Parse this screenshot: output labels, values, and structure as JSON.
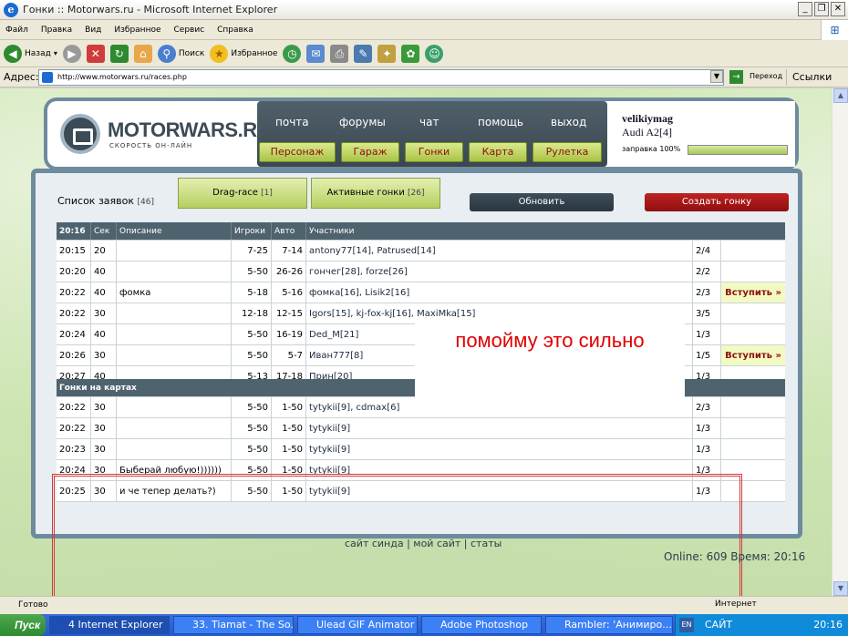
{
  "window": {
    "title": "Гонки :: Motorwars.ru - Microsoft Internet Explorer"
  },
  "menu": [
    "Файл",
    "Правка",
    "Вид",
    "Избранное",
    "Сервис",
    "Справка"
  ],
  "toolbar": {
    "back": "Назад",
    "search": "Поиск",
    "favorites": "Избранное"
  },
  "address": {
    "label": "Адрес:",
    "url": "http://www.motorwars.ru/races.php",
    "go": "Переход",
    "links": "Ссылки"
  },
  "site": {
    "logo": "MOTORWARS.RU",
    "slogan": "СКОРОСТЬ ОН-ЛАЙН",
    "nav_top": [
      "почта",
      "форумы",
      "чат",
      "помощь",
      "выход"
    ],
    "nav_bottom": [
      "Персонаж",
      "Гараж",
      "Гонки",
      "Карта",
      "Рулетка"
    ],
    "user": {
      "name": "velikiymag",
      "car": "Audi A2[4]",
      "fuel_label": "заправка 100%",
      "fuel": 1.0
    }
  },
  "races": {
    "list_title": "Список заявок",
    "list_count": "[46]",
    "tab_drag": "Drag-race",
    "tab_drag_count": "[1]",
    "tab_active": "Активные гонки",
    "tab_active_count": "[26]",
    "refresh": "Обновить",
    "create": "Создать гонку",
    "headers": [
      "20:16",
      "Сек",
      "Описание",
      "Игроки",
      "Авто",
      "Участники"
    ],
    "rows": [
      {
        "time": "20:15",
        "sec": "20",
        "desc": "",
        "players": "7-25",
        "auto": "7-14",
        "participants": "antony77[14], Patrused[14]",
        "count": "2/4",
        "join": ""
      },
      {
        "time": "20:20",
        "sec": "40",
        "desc": "",
        "players": "5-50",
        "auto": "26-26",
        "participants": "гончег[28], forze[26]",
        "count": "2/2",
        "join": ""
      },
      {
        "time": "20:22",
        "sec": "40",
        "desc": "фомка",
        "players": "5-18",
        "auto": "5-16",
        "participants": "фомка[16], Lisik2[16]",
        "count": "2/3",
        "join": "Вступить »"
      },
      {
        "time": "20:22",
        "sec": "30",
        "desc": "",
        "players": "12-18",
        "auto": "12-15",
        "participants": "Igors[15],      kj-fox-kj[16], MaxiMka[15]",
        "count": "3/5",
        "join": ""
      },
      {
        "time": "20:24",
        "sec": "40",
        "desc": "",
        "players": "5-50",
        "auto": "16-19",
        "participants": "Ded_M[21]",
        "count": "1/3",
        "join": ""
      },
      {
        "time": "20:26",
        "sec": "30",
        "desc": "",
        "players": "5-50",
        "auto": "5-7",
        "participants": "Иван777[8]",
        "count": "1/5",
        "join": "Вступить »"
      },
      {
        "time": "20:27",
        "sec": "40",
        "desc": "",
        "players": "5-13",
        "auto": "17-18",
        "participants": "Прин[20]",
        "count": "1/3",
        "join": ""
      }
    ],
    "map_title": "Гонки на картах",
    "map_rows": [
      {
        "time": "20:22",
        "sec": "30",
        "desc": "",
        "players": "5-50",
        "auto": "1-50",
        "participants": "tytykii[9], cdmax[6]",
        "count": "2/3"
      },
      {
        "time": "20:22",
        "sec": "30",
        "desc": "",
        "players": "5-50",
        "auto": "1-50",
        "participants": "tytykii[9]",
        "count": "1/3"
      },
      {
        "time": "20:23",
        "sec": "30",
        "desc": "",
        "players": "5-50",
        "auto": "1-50",
        "participants": "tytykii[9]",
        "count": "1/3"
      },
      {
        "time": "20:24",
        "sec": "30",
        "desc": "Быберай любую!))))))",
        "players": "5-50",
        "auto": "1-50",
        "participants": "tytykii[9]",
        "count": "1/3"
      },
      {
        "time": "20:25",
        "sec": "30",
        "desc": "и че тепер делать?)",
        "players": "5-50",
        "auto": "1-50",
        "participants": "tytykii[9]",
        "count": "1/3"
      }
    ]
  },
  "overlay_text": "помойму это сильно",
  "footer": {
    "links": "сайт синда | мой сайт | статы",
    "online": "Online: 609  Время: 20:16"
  },
  "status": {
    "text": "Готово",
    "zone": "Интернет"
  },
  "taskbar": {
    "start": "Пуск",
    "tasks": [
      "4 Internet Explorer",
      "33. Tiamat - The So...",
      "Ulead GIF Animator ...",
      "Adobe Photoshop",
      "Rambler: 'Анимиро..."
    ],
    "lang": "EN",
    "user": "САЙТ",
    "clock": "20:16"
  },
  "colors": {
    "accent_red": "#e00000",
    "nav_green": "#a9c446",
    "panel_slate": "#4f636f"
  }
}
